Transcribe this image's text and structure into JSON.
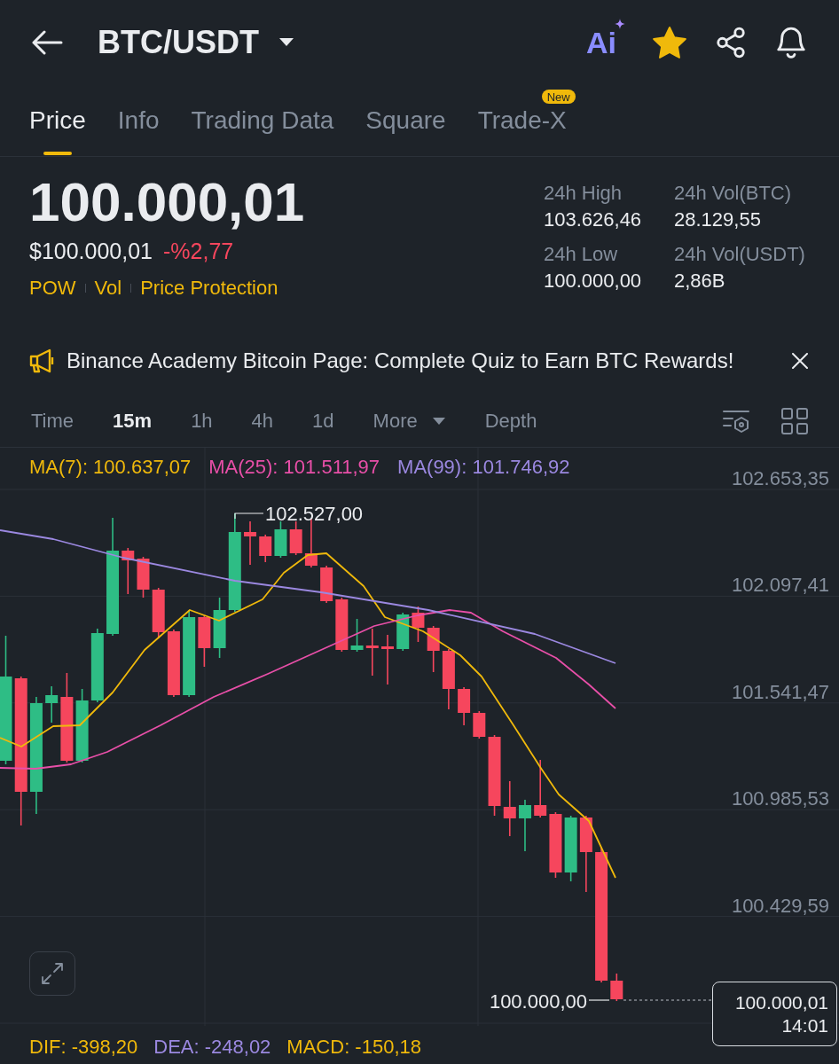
{
  "header": {
    "title": "BTC/USDT",
    "ai_label": "Ai"
  },
  "tabs": [
    {
      "label": "Price",
      "selected": true
    },
    {
      "label": "Info",
      "selected": false
    },
    {
      "label": "Trading Data",
      "selected": false
    },
    {
      "label": "Square",
      "selected": false
    },
    {
      "label": "Trade-X",
      "selected": false,
      "badge": "New"
    }
  ],
  "price": {
    "last": "100.000,01",
    "fiat": "$100.000,01",
    "change": "-%2,77",
    "tags": [
      "POW",
      "Vol",
      "Price Protection"
    ]
  },
  "stats": [
    {
      "label": "24h High",
      "value": "103.626,46"
    },
    {
      "label": "24h Vol(BTC)",
      "value": "28.129,55"
    },
    {
      "label": "24h Low",
      "value": "100.000,00"
    },
    {
      "label": "24h Vol(USDT)",
      "value": "2,86B"
    }
  ],
  "announcement": {
    "text": "Binance Academy Bitcoin Page: Complete Quiz to Earn BTC Rewards!"
  },
  "intervals": [
    {
      "label": "Time",
      "kind": "option",
      "selected": false
    },
    {
      "label": "15m",
      "kind": "option",
      "selected": true
    },
    {
      "label": "1h",
      "kind": "option",
      "selected": false
    },
    {
      "label": "4h",
      "kind": "option",
      "selected": false
    },
    {
      "label": "1d",
      "kind": "option",
      "selected": false
    },
    {
      "label": "More",
      "kind": "dropdown",
      "selected": false
    },
    {
      "label": "Depth",
      "kind": "option",
      "selected": false
    }
  ],
  "chart": {
    "indicators": [
      {
        "label": "MA(7): 100.637,07",
        "color": "#f0b90b"
      },
      {
        "label": "MA(25): 101.511,97",
        "color": "#e84fa8"
      },
      {
        "label": "MA(99): 101.746,92",
        "color": "#9b88e0"
      }
    ],
    "y_axis": [
      "102.653,35",
      "102.097,41",
      "101.541,47",
      "100.985,53",
      "100.429,59"
    ],
    "high_label": "102.527,00",
    "low_label": "100.000,00",
    "last_price": "100.000,01",
    "countdown": "14:01"
  },
  "macd": [
    {
      "label": "DIF: -398,20",
      "color": "#f0b90b"
    },
    {
      "label": "DEA: -248,02",
      "color": "#9b88e0"
    },
    {
      "label": "MACD: -150,18",
      "color": "#f0b90b"
    }
  ]
}
